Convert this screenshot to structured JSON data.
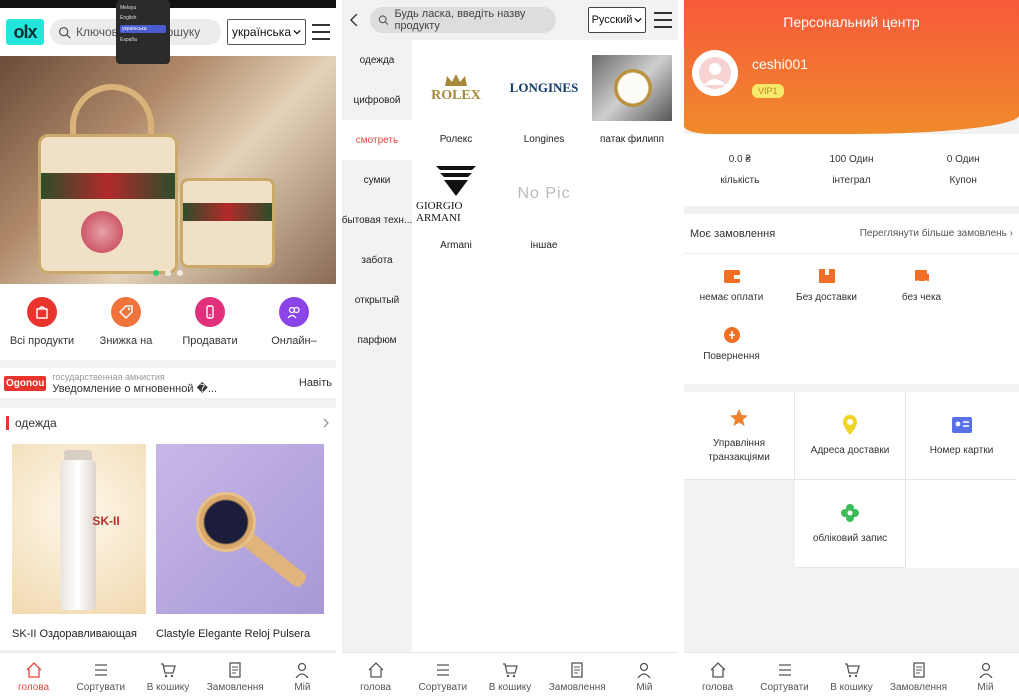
{
  "screen1": {
    "logo": "olx",
    "search_placeholder": "Ключові слова пошуку",
    "language": "українська",
    "lang_options": [
      "Melayu",
      "English",
      "українська",
      "España"
    ],
    "quick_links": [
      {
        "label": "Всі продукти",
        "color": "#e8342c"
      },
      {
        "label": "Знижка на",
        "color": "#f0733c"
      },
      {
        "label": "Продавати",
        "color": "#e0307a"
      },
      {
        "label": "Онлайн–",
        "color": "#8b44e8"
      }
    ],
    "notice_badge": "Ogonou",
    "notice_line1": "государственная амнистия",
    "notice_line2": "Уведомление о мгновенной �...",
    "notice_more": "Навіть",
    "section_title": "одежда",
    "products": [
      {
        "title": "SK-II Оздоравливающая",
        "brand": "SK-II"
      },
      {
        "title": "Clastyle Elegante Reloj Pulsera"
      }
    ]
  },
  "screen2": {
    "search_placeholder": "Будь ласка, введіть назву продукту",
    "language": "Русский",
    "categories": [
      "одежда",
      "цифровой",
      "смотреть",
      "сумки",
      "бытовая техн...",
      "забота",
      "открытый",
      "парфюм"
    ],
    "active_category": "смотреть",
    "brands": [
      {
        "name": "Ролекс",
        "logo": "ROLEX"
      },
      {
        "name": "Longines",
        "logo": "LONGINES"
      },
      {
        "name": "патак филипп"
      },
      {
        "name": "Armani",
        "logo": "GIORGIO ARMANI"
      },
      {
        "name": "іншае",
        "logo": "No Pic"
      }
    ]
  },
  "screen3": {
    "title": "Персональний центр",
    "username": "ceshi001",
    "vip": "VIP1",
    "stats": [
      {
        "value": "0.0 ₴",
        "label": "кількість"
      },
      {
        "value": "100 Один",
        "label": "інтеграл"
      },
      {
        "value": "0 Один",
        "label": "Купон"
      }
    ],
    "orders_title": "Моє замовлення",
    "orders_more": "Переглянути більше замовлень",
    "orders": [
      "немає оплати",
      "Без доставки",
      "без чека",
      "Повернення"
    ],
    "grid": [
      "Управління транзакціями",
      "Адреса доставки",
      "Номер картки",
      "обліковий запис"
    ]
  },
  "tabbar": [
    "голова",
    "Сортувати",
    "В кошику",
    "Замовлення",
    "Мій"
  ],
  "colors": {
    "accent": "#e8453c",
    "header_orange": "#f75a3a"
  }
}
